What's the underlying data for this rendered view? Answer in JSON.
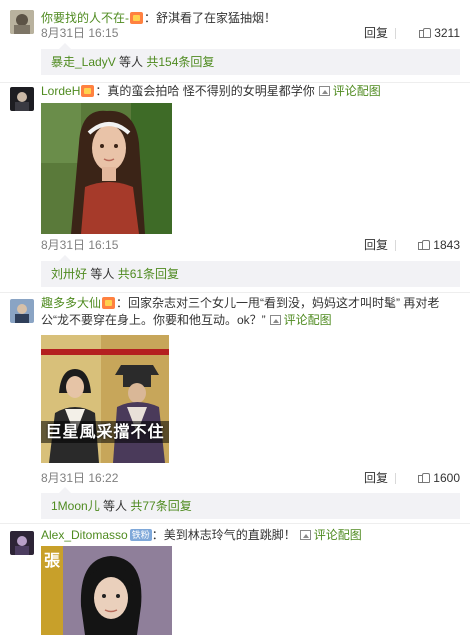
{
  "comments": [
    {
      "user": "你要找的人不在-",
      "text": "：舒淇看了在家猛抽烟！",
      "time": "8月31日 16:15",
      "reply_label": "回复",
      "likes": "3211",
      "sub": {
        "users": "暴走_LadyV",
        "mid": " 等人 ",
        "total": "共154条回复"
      }
    },
    {
      "user": "LordeH",
      "text": "：真的蛮会拍哈 怪不得别的女明星都学你",
      "pic_link": "评论配图",
      "time": "8月31日 16:15",
      "reply_label": "回复",
      "likes": "1843",
      "sub": {
        "users": "刘卅好",
        "mid": " 等人 ",
        "total": "共61条回复"
      }
    },
    {
      "user": "趣多多大仙",
      "text": "：回家杂志对三个女儿一甩“看到没，妈妈这才叫时髦” 再对老公“龙不要穿在身上。你要和他互动。ok？”",
      "pic_link": "评论配图",
      "photo_caption": "巨星風采擋不住",
      "time": "8月31日 16:22",
      "reply_label": "回复",
      "likes": "1600",
      "sub": {
        "users": "1Moon儿",
        "mid": " 等人 ",
        "total": "共77条回复"
      }
    },
    {
      "user": "Alex_Ditomasso",
      "badge": "铁粉",
      "text": "：美到林志玲气的直跳脚！",
      "pic_link": "评论配图",
      "photo_caption": "張"
    }
  ],
  "colors": {
    "link_green": "#4f8b20",
    "name_orange": "#eb7350",
    "sub_bg": "#f2f2f5",
    "meta_gray": "#808080"
  },
  "icons": [
    "vip-crown-icon",
    "picture-icon",
    "thumb-up-icon"
  ]
}
